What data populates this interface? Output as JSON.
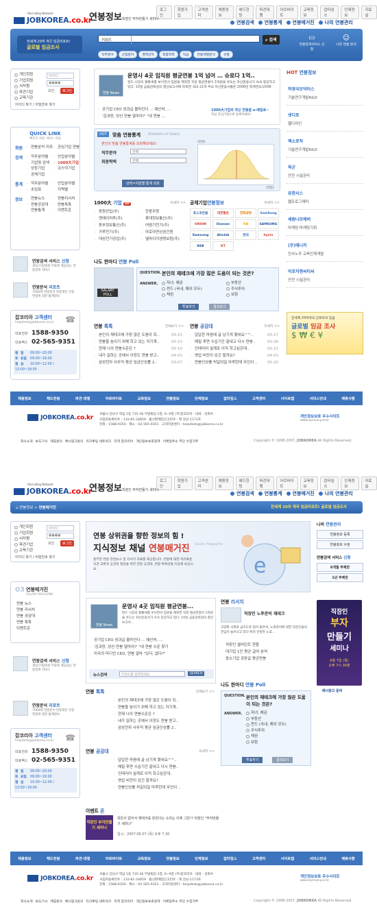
{
  "top_links": [
    "로그인",
    "회원가입",
    "고객센터",
    "채용정보",
    "헤드헌팅",
    "파견대행",
    "아르바이트",
    "교육정보",
    "잡타임스",
    "인재정보",
    "자료실"
  ],
  "brand": {
    "network": "Recruiting Network",
    "logo": "JOBKOREA",
    "domain": ".co.kr",
    "service": "연봉정보",
    "service_sub": "직장인 부자만들기 세미나"
  },
  "main_menu": [
    "연봉검색",
    "연봉통계",
    "연봉매거진",
    "나의 연봉관리"
  ],
  "search": {
    "select": "키워드",
    "button": "검색"
  },
  "promo_left": {
    "line1": "전세계 20여 개국 임금리포트!",
    "line2": "글로벌 임금조사"
  },
  "promo_right": {
    "label1": "연봉검색서비스 신청",
    "label2": "나만 연봉 분석"
  },
  "categories": [
    "직무분야",
    "산업분야",
    "경력년차",
    "최종학력",
    "직급",
    "연봉계열분석",
    "성별"
  ],
  "login": {
    "radios": [
      "개인회원",
      "기업회원",
      "서치펌",
      "파견기업",
      "교육기관"
    ],
    "id_placeholder": "아이디",
    "pw_placeholder": "●●●●",
    "save": "보안",
    "login_btn": "로그인",
    "find": "아이디 찾기 / 비밀번호 찾기"
  },
  "quick_link": {
    "title": "QUICK LINK",
    "sub": "빠르고 쉬운 서비스 이용",
    "groups": [
      {
        "head": "회원",
        "items": [
          "연봉분석 리포트",
          "관심기업 연봉 알리미"
        ]
      },
      {
        "head": "검색",
        "items": [
          "직무분야별",
          "산업분야별",
          "기업명 검색",
          "1000大기업",
          "상장기업",
          "코스닥기업",
          "공채기업"
        ]
      },
      {
        "head": "통계",
        "items": [
          "직무분야별",
          "산업분야별",
          "초임표",
          "지역별"
        ]
      },
      {
        "head": "정보",
        "items": [
          "연봉뉴스",
          "연봉리서치",
          "연봉공감대",
          "연봉톡톡",
          "연봉통계",
          "이벤트존"
        ]
      }
    ]
  },
  "left_service": {
    "title": "연봉검색 서비스",
    "hl": "신청",
    "desc": "개인/기업회원 무료로 제공되는 연봉검색 서비스"
  },
  "left_report": {
    "title": "연봉분석",
    "hl": "리포트",
    "desc": "7000여 연봉분석 연봉개인 인정 연봉에 대한 통계정보"
  },
  "cs": {
    "title": "잡코리아",
    "hl": "고객센터",
    "email": "helpdesk@jobkorea.co.kr",
    "tel_label": "대표전화",
    "tel": "1588-9350",
    "fax_label": "대표팩스",
    "fax": "02-565-9351",
    "hours": [
      [
        "평",
        "일",
        "09:00~20:00"
      ],
      [
        "토",
        "요일",
        "09:00~18:00"
      ],
      [
        "점",
        "심",
        "10:00~12:00 / 13:00~18:00"
      ]
    ]
  },
  "news": {
    "badge": "연봉 News",
    "headline": "운영사 4곳 임직원 평균연봉 1억 넘어 … 슈로다 1억..",
    "body": "펀드 시장의 활황세를 보이면서 임원을 제외한 직원 평균연봉이 1억원을 웃도는 자산운용사가 속속 등장하고 있다. 10일 금융감독원의 결산보고서에 따르면 국내 21개 주요 자산운용사들은 2006년 회계연도(2006",
    "items": [
      "공기업 CEO 성과급 올마인다 ... 예산처, ...",
      "'김과장, 당신 연봉 얼마야?' \"내 연봉 ..."
    ],
    "side": "1000大기업의 최신 연봉을 e-메일로~",
    "side_sub": "지금 관심기업으로 등록하세요!"
  },
  "fit": {
    "badge": "HOT",
    "title": "맞춤 연봉통계",
    "en": "Statistics of Salary",
    "hint": "본인의 맞춤 연봉통계를 조회해보세요!",
    "fields": [
      [
        "직무분야",
        "선택"
      ],
      [
        "최종학력",
        "선택"
      ]
    ],
    "button": "강력=지원별 통계 조회",
    "unit": "(만원)",
    "xaxis": "(연봉)"
  },
  "big1000": {
    "title": "1000大",
    "hl": "기업",
    "badge": "UP",
    "more": "자세히 >>",
    "left": [
      "동원산업(주)",
      "엔에이치투(주)",
      "동부정보통신(주)",
      "가루전기(주)",
      "대성전기공업(주)"
    ],
    "right": [
      "한종무원",
      "롯데정보통신(주)",
      "어떰기전기(주)",
      "아로아연상권건원",
      "엘라이지생명보험(주)"
    ]
  },
  "gonggo": {
    "title": "공채기업",
    "hl": "연봉정보",
    "more": "자세히 >>",
    "logos": [
      "포스코건설",
      "대한통운",
      "한화생명",
      "SamSung",
      "ORION",
      "Doosan",
      "KB",
      "SAMSUNG",
      "Samsung",
      "Ahnlab",
      "현대",
      "hynix",
      "KEB",
      "KT"
    ]
  },
  "poll": {
    "title": "나도 한마디",
    "hl": "연봉 Poll",
    "question_label": "QUESTION.",
    "question": "본인의 재테크에 가장 많은 도움이 되는 것은?",
    "answer_label": "ANSWER.",
    "options": [
      "자녀, 예금",
      "펀드 (국내, 해외 모두)",
      "채권",
      "부동산",
      "주식투자",
      "보험"
    ],
    "vote": "투표하기",
    "result": "결과보기",
    "img": "SALARY POLL"
  },
  "sympathy": {
    "title": "연봉",
    "hl": "톡톡",
    "more": "전체보기 >>",
    "items": [
      [
        "본인의 재테크에 가장 많은 도움이 되..",
        "05-23"
      ],
      [
        "연봉을 높이기 위해 하고 있는 자기계..",
        "05-23"
      ],
      [
        "현재 나의 연봉수준은 ?",
        "05-10"
      ],
      [
        "내가 일하는 곳에서 이정도 연봉 받고..",
        "04-03"
      ],
      [
        "삼성전자 사무직 평균 임금인상률 2..",
        "03-07"
      ]
    ]
  },
  "gongam": {
    "title": "연봉",
    "hl": "공감대",
    "more": "자세히 >>",
    "items": [
      [
        "답답한 마음에 글 남기게 됐네요^^..",
        "05-27"
      ],
      [
        "매질 후면 수습기간 끝내고 다시 연봉..",
        "05-26"
      ],
      [
        "인테리어 설계로 이직 하고싶은데..",
        "05-21"
      ],
      [
        "영업 비전이 있긴 할까요?",
        "04-03"
      ],
      [
        "연봉인상를 처일되일 마루런데 무인이 ..",
        "05-20"
      ]
    ]
  },
  "right_hot": {
    "title": "HOT",
    "hl": "연봉정보",
    "sections": [
      [
        "하영국모닥터스",
        "기술연구개발R&D"
      ],
      [
        "넷디포",
        "웹디자인"
      ],
      [
        "엑소로직",
        "기술연구개발R&D"
      ],
      [
        "육군",
        "안전 시설관리"
      ],
      [
        "유한사스",
        "웹프로그래머"
      ],
      [
        "세원나모에버",
        "마케팅·마케팅기획"
      ],
      [
        "(주)에니카",
        "인사노무 교육인재개발"
      ],
      [
        "이포지앤씨티씨",
        "안전 시설관리"
      ]
    ]
  },
  "right_banner": {
    "line1": "전세계 20여개국 근로자의 임금",
    "line2": "글로벌",
    "line3": "임금 조사"
  },
  "footer": {
    "menu": [
      "채용정보",
      "헤드헌팅",
      "파견·대행",
      "아르바이트",
      "교육정보",
      "연봉정보",
      "인재정보",
      "잡타임스",
      "고객센터",
      "사이트맵",
      "서비스안내",
      "제휴사항"
    ],
    "addr1": "서울시 강남구 역삼 1동 735-36 부방빌딩 2층, 6~9층 (주)잡코리아 · 대표 : 김화수",
    "addr2": "사업자등록번호 : 110-81-34859 · 통신판매업신고번호 : 제 강남-1173호",
    "tel": "전화 : 1588-9350",
    "fax": "팩스 : 02-565-9351",
    "mail": "고객지원센터 : helpdesk@jobkorea.co.kr",
    "links": [
      "회사소개",
      "보도기사",
      "제휴문의",
      "배너광고문의",
      "리크루팅 네트워크",
      "지역 잡코리아",
      "개인정보보호정책",
      "이메일주소 무단 수집거부"
    ],
    "copy": "Copyright © 1998-2007,",
    "copy2": "All Rights Reserved.",
    "privacy": "개인정보보호 우수사이트",
    "privacy_url": "www.eprivacy.or.kr"
  },
  "p2": {
    "breadcrumb": [
      "연봉정보",
      "연봉매거진"
    ],
    "banner": "전세계 20여 개국 임금리포트! 글로벌 임금조사",
    "left_menu_title": "연봉매거진",
    "left_menu_en": "SALARY MAGAZINE",
    "left_menu_num": "03",
    "left_menu": [
      "연봉 뉴스",
      "연봉 리서치",
      "연봉 공감대",
      "연봉 톡톡",
      "이벤트존"
    ],
    "hero_line1": "연봉 상위권을 향한 정보의 힘 !",
    "hero_line2": "지식정보 채널",
    "hero_hl": "연봉매거진",
    "hero_desc": "풍부한 연봉 관련뉴스 및 리서치 자료를 제공합니다. 연봉에 대한 자유로운 의견 교환과 공감대 형성을 위한 연봉 공감대, 연봉 톡톡란을 이용해 보십시요.",
    "hero_en": "Salary Magazine",
    "news_headline": "운영사 4곳 임직원 평균연봉...",
    "news_body": "펀드 시장의 활황세를 보이면서 임원을 제외한 직원 평균연봉이 1억원을 웃도는 자산운용사가 속속 등장하고 있다. 10일 금융감독원의 결산보고서...",
    "news_items": [
      "공기업 CEO 성과급 올마인다 ... 예산처, ...",
      "'김과장, 당신 연봉 얼마야?' \"내 연봉 수준 찾기",
      "미국의 미디언 CEO, 연봉 얼마 \"있다, 없다?\""
    ],
    "news_search_label": "뉴스검색",
    "news_search_ph": "키워드를 입력하세요",
    "news_search_btn": "SEARCH",
    "research_title": "연봉",
    "research_hl": "리서치",
    "research_head": "직장인 노후준비 재테크",
    "research_body": "고령화 사회로 급속도로 접어 들면서, 노후준비에 대한 직장인들의 관심이 늘어나고 있다 특히 안정된 노후...",
    "research_items": [
      "직장인 셀러던트 현황",
      "대기업 1인 평균 급여 분석",
      "중소기업 과장급 평균연봉"
    ],
    "myinfo_title": "나의",
    "myinfo_hl": "연봉관리",
    "myinfo_items": [
      "연봉정보 등록",
      "연봉정보 수정"
    ],
    "mysvc_title": "연봉검색 서비스",
    "mysvc_hl": "신청",
    "mysvc_items": [
      "6개월 무제한",
      "1년 무제한"
    ],
    "ad_line1": "직장인",
    "ad_line2": "부자",
    "ad_line3": "만들기",
    "ad_line4": "세미나",
    "ad_date": "6월 7일 (목)",
    "ad_time": "오후 7시 30분",
    "ad_caption": "배너광고 문의",
    "event_title": "이벤트",
    "event_hl": "존",
    "event_text": "목돈이 없어서 재테크를 못한다는 소리는 이제 그만!? 직장인 \"부자만들기 세미나\"",
    "event_date": "일시 : 2007.06.07 (목) 오후 7:30",
    "event_img": "직장인 부자만들기 세미나"
  }
}
